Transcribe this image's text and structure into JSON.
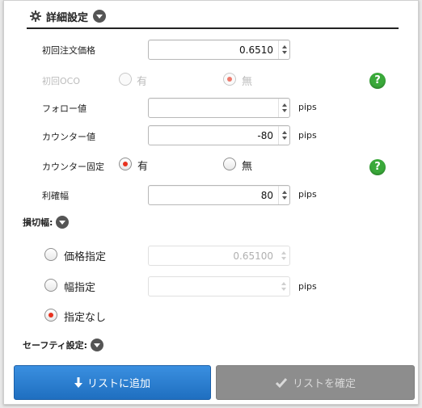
{
  "header": {
    "title": "詳細設定"
  },
  "fields": {
    "initial_order_price": {
      "label": "初回注文価格",
      "value": "0.6510"
    },
    "initial_oco": {
      "label": "初回OCO",
      "option_yes": "有",
      "option_no": "無",
      "selected": "no"
    },
    "follow_value": {
      "label": "フォロー値",
      "value": "",
      "unit": "pips"
    },
    "counter_value": {
      "label": "カウンター値",
      "value": "-80",
      "unit": "pips"
    },
    "counter_fixed": {
      "label": "カウンター固定",
      "option_yes": "有",
      "option_no": "無",
      "selected": "yes"
    },
    "take_profit": {
      "label": "利確幅",
      "value": "80",
      "unit": "pips"
    }
  },
  "stop_loss": {
    "label": "損切幅:",
    "options": {
      "price": {
        "label": "価格指定",
        "value": "0.65100"
      },
      "width": {
        "label": "幅指定",
        "value": "",
        "unit": "pips"
      },
      "none": {
        "label": "指定なし"
      }
    },
    "selected": "none"
  },
  "safety": {
    "label": "セーフティ設定:"
  },
  "buttons": {
    "add_to_list": "リストに追加",
    "confirm_list": "リストを確定"
  },
  "help_icon_text": "?",
  "colors": {
    "accent_blue": "#2a7fd4",
    "radio_red": "#e8321f",
    "help_green": "#3aa93a",
    "disabled_gray": "#8d8d8d"
  }
}
